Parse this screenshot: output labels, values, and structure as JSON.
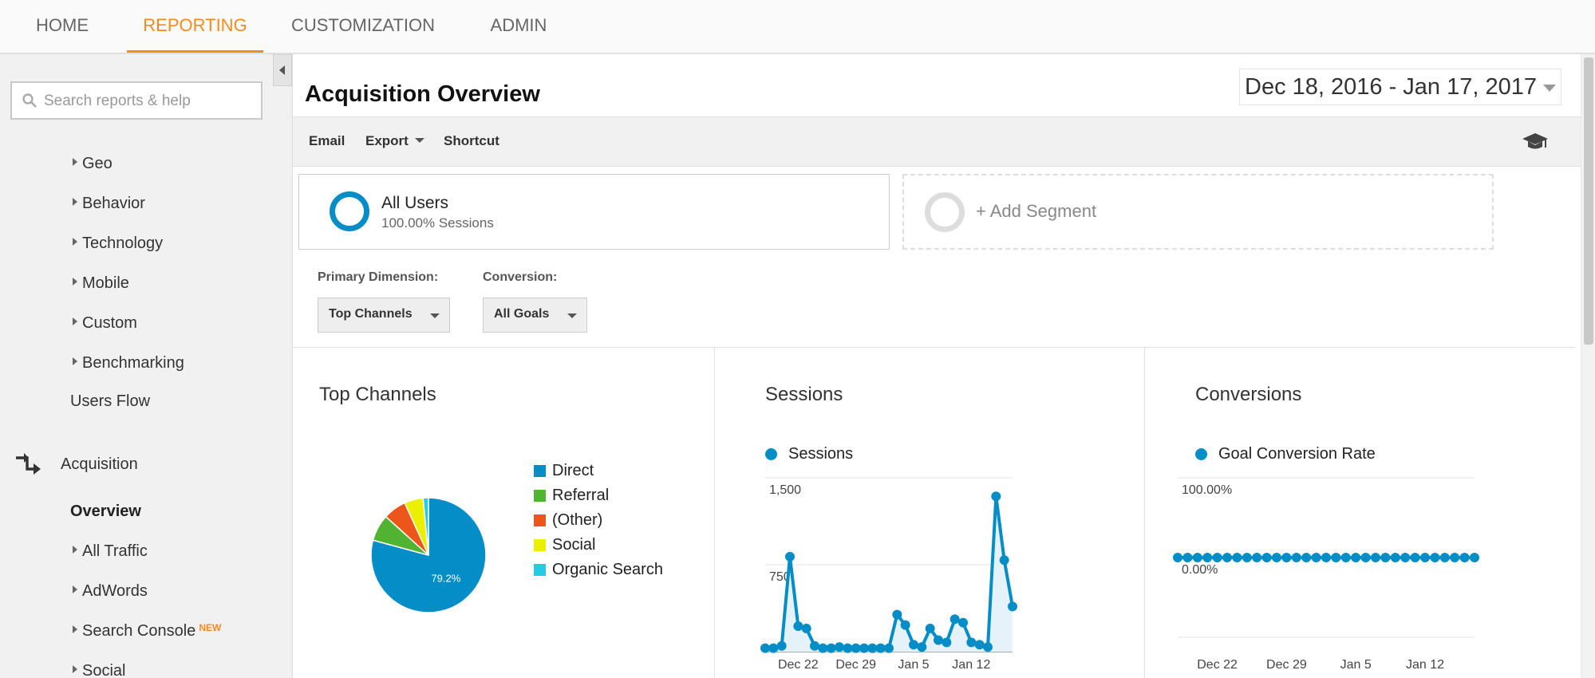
{
  "topnav": {
    "tabs": [
      {
        "label": "HOME",
        "active": false
      },
      {
        "label": "REPORTING",
        "active": true
      },
      {
        "label": "CUSTOMIZATION",
        "active": false
      },
      {
        "label": "ADMIN",
        "active": false
      }
    ],
    "accent_color": "#f48b1f"
  },
  "sidebar": {
    "search_placeholder": "Search reports & help",
    "items": [
      {
        "label": "Geo"
      },
      {
        "label": "Behavior"
      },
      {
        "label": "Technology"
      },
      {
        "label": "Mobile"
      },
      {
        "label": "Custom"
      },
      {
        "label": "Benchmarking"
      },
      {
        "label": "Users Flow"
      },
      {
        "label": "Acquisition"
      },
      {
        "label": "Overview"
      },
      {
        "label": "All Traffic"
      },
      {
        "label": "AdWords"
      },
      {
        "label": "Search Console",
        "badge": "NEW"
      },
      {
        "label": "Social"
      }
    ]
  },
  "main": {
    "title": "Acquisition Overview",
    "date_range": "Dec 18, 2016 - Jan 17, 2017",
    "toolbar": {
      "email": "Email",
      "export": "Export",
      "shortcut": "Shortcut"
    },
    "segments": {
      "all_users": {
        "name": "All Users",
        "sub": "100.00% Sessions"
      },
      "add": "+ Add Segment"
    },
    "primary_dimension": {
      "label": "Primary Dimension:",
      "value": "Top Channels"
    },
    "conversion": {
      "label": "Conversion:",
      "value": "All Goals"
    }
  },
  "panels": {
    "top_channels": {
      "title": "Top Channels"
    },
    "sessions": {
      "title": "Sessions",
      "legend": "Sessions"
    },
    "conversions": {
      "title": "Conversions",
      "legend": "Goal Conversion Rate"
    }
  },
  "chart_data": [
    {
      "type": "pie",
      "title": "Top Channels",
      "categories": [
        "Direct",
        "Referral",
        "(Other)",
        "Social",
        "Organic Search"
      ],
      "values": [
        79.2,
        7.5,
        6.5,
        5.3,
        1.5
      ],
      "colors": [
        "#058dc7",
        "#50b432",
        "#ed561b",
        "#edef00",
        "#24cbe5"
      ],
      "data_labels": [
        "79.2%",
        "",
        "",
        "",
        ""
      ]
    },
    {
      "type": "line",
      "title": "Sessions",
      "series": [
        {
          "name": "Sessions",
          "values": [
            30,
            30,
            50,
            820,
            220,
            200,
            50,
            30,
            30,
            40,
            30,
            30,
            30,
            30,
            30,
            30,
            320,
            230,
            60,
            40,
            200,
            100,
            80,
            280,
            250,
            80,
            60,
            40,
            1340,
            790,
            390
          ]
        }
      ],
      "ytick_labels": [
        "1,500",
        "750"
      ],
      "ytick_values": [
        1500,
        750
      ],
      "xtick_labels": [
        "Dec 22",
        "Dec 29",
        "Jan 5",
        "Jan 12"
      ],
      "xtick_indices": [
        4,
        11,
        18,
        25
      ],
      "ylim": [
        0,
        1500
      ],
      "color": "#058dc7"
    },
    {
      "type": "line",
      "title": "Conversions",
      "series": [
        {
          "name": "Goal Conversion Rate",
          "values": [
            0,
            0,
            0,
            0,
            0,
            0,
            0,
            0,
            0,
            0,
            0,
            0,
            0,
            0,
            0,
            0,
            0,
            0,
            0,
            0,
            0,
            0,
            0,
            0,
            0,
            0,
            0,
            0,
            0,
            0,
            0
          ]
        }
      ],
      "ytick_labels": [
        "100.00%",
        "0.00%"
      ],
      "ytick_values": [
        100,
        0
      ],
      "xtick_labels": [
        "Dec 22",
        "Dec 29",
        "Jan 5",
        "Jan 12"
      ],
      "xtick_indices": [
        4,
        11,
        18,
        25
      ],
      "ylim": [
        -100,
        100
      ],
      "color": "#058dc7"
    }
  ]
}
